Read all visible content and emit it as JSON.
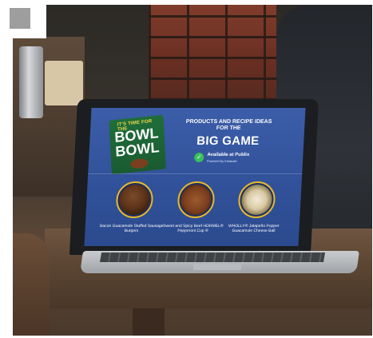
{
  "screen": {
    "logo": {
      "tag": "IT'S TIME FOR THE",
      "word_line1": "BOWL",
      "word_line2": "BOWL"
    },
    "headline_small": "PRODUCTS AND RECIPE IDEAS FOR THE",
    "headline_big": "BIG GAME",
    "availability": {
      "icon": "check-icon",
      "text": "Available at Publix",
      "subtext": "Powered by Instacart"
    },
    "items": [
      {
        "caption": "Bacon Guacamole Stuffed Sausage Burgers"
      },
      {
        "caption": "Sweet and Spicy Beef HORMEL® Pepperoni Cup ®"
      },
      {
        "caption": "WHOLLY® Jalapeño Popper Guacamole Cheese Ball"
      }
    ]
  },
  "colors": {
    "screen_blue": "#31519a",
    "logo_green": "#1f6e3a",
    "ring_gold": "#e7b92c",
    "check_green": "#3bbf5a"
  }
}
